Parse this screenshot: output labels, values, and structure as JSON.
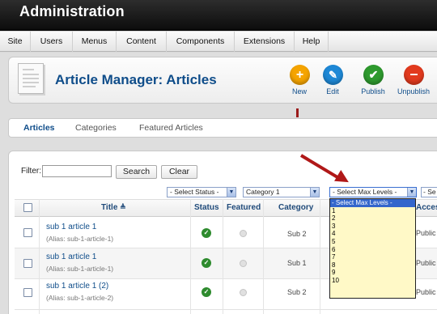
{
  "header": {
    "title": "Administration"
  },
  "menu": [
    "Site",
    "Users",
    "Menus",
    "Content",
    "Components",
    "Extensions",
    "Help"
  ],
  "page_title": "Article Manager: Articles",
  "toolbar": [
    {
      "label": "New",
      "icon": "plus-icon",
      "color": "#f5a400"
    },
    {
      "label": "Edit",
      "icon": "pencil-icon",
      "color": "#1e88d6"
    },
    {
      "label": "Publish",
      "icon": "check-icon",
      "color": "#2e9a2e"
    },
    {
      "label": "Unpublish",
      "icon": "minus-icon",
      "color": "#e23a1e"
    }
  ],
  "tabs": [
    "Articles",
    "Categories",
    "Featured Articles"
  ],
  "filter": {
    "label": "Filter:",
    "value": "",
    "search_label": "Search",
    "clear_label": "Clear"
  },
  "selects": {
    "status": "- Select Status -",
    "category": "Category 1",
    "max_levels": "- Select Max Levels -",
    "access": "- Se"
  },
  "columns": {
    "title": "Title",
    "status": "Status",
    "featured": "Featured",
    "category": "Category",
    "access": "Access"
  },
  "rows": [
    {
      "title": "sub 1 article 1",
      "alias": "(Alias: sub-1-article-1)",
      "category": "Sub 2",
      "access": "Public"
    },
    {
      "title": "sub 1 article 1",
      "alias": "(Alias: sub-1-article-1)",
      "category": "Sub 1",
      "access": "Public"
    },
    {
      "title": "sub 1 article 1 (2)",
      "alias": "(Alias: sub-1-article-2)",
      "category": "Sub 2",
      "access": "Public"
    }
  ],
  "max_levels_options": [
    "- Select Max Levels -",
    "1",
    "2",
    "3",
    "4",
    "5",
    "6",
    "7",
    "8",
    "9",
    "10"
  ],
  "colors": {
    "accent": "#0f4d8a",
    "header_bg": "#1a1a1a",
    "dropdown_bg": "#fff9c7",
    "annotation": "#b01818"
  }
}
